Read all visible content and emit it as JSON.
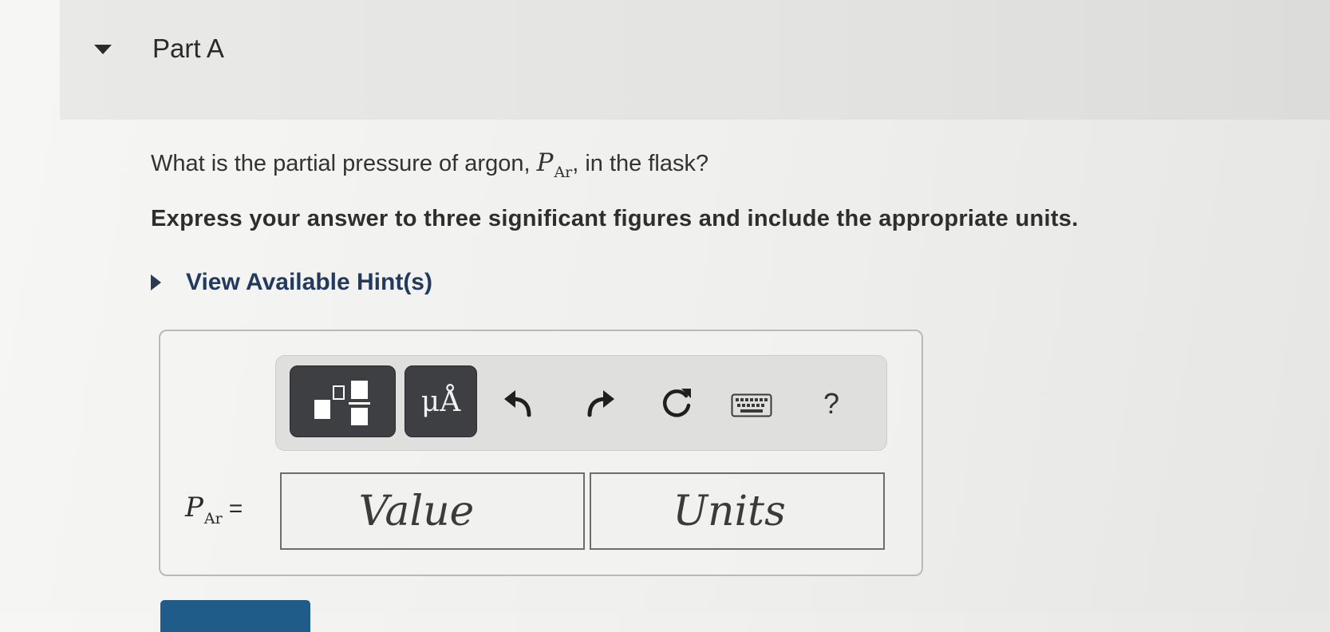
{
  "part": {
    "title": "Part A"
  },
  "question": {
    "prefix": "What is the partial pressure of argon,",
    "variable": "P",
    "subscript": "Ar",
    "suffix": ", in the flask?"
  },
  "instruction": "Express your answer to three significant figures and include the appropriate units.",
  "hints": {
    "label": "View Available Hint(s)"
  },
  "toolbar": {
    "templates_icon": "templates-icon",
    "units_label": "μÅ",
    "undo_icon": "undo-icon",
    "redo_icon": "redo-icon",
    "reset_icon": "reset-icon",
    "keyboard_icon": "keyboard-icon",
    "help_label": "?"
  },
  "answer": {
    "variable": "P",
    "subscript": "Ar",
    "equals": "=",
    "value_placeholder": "Value",
    "units_placeholder": "Units"
  },
  "colors": {
    "toolbar_button": "#3d3f42",
    "link": "#223a5e",
    "submit_button": "#1f5c89"
  }
}
